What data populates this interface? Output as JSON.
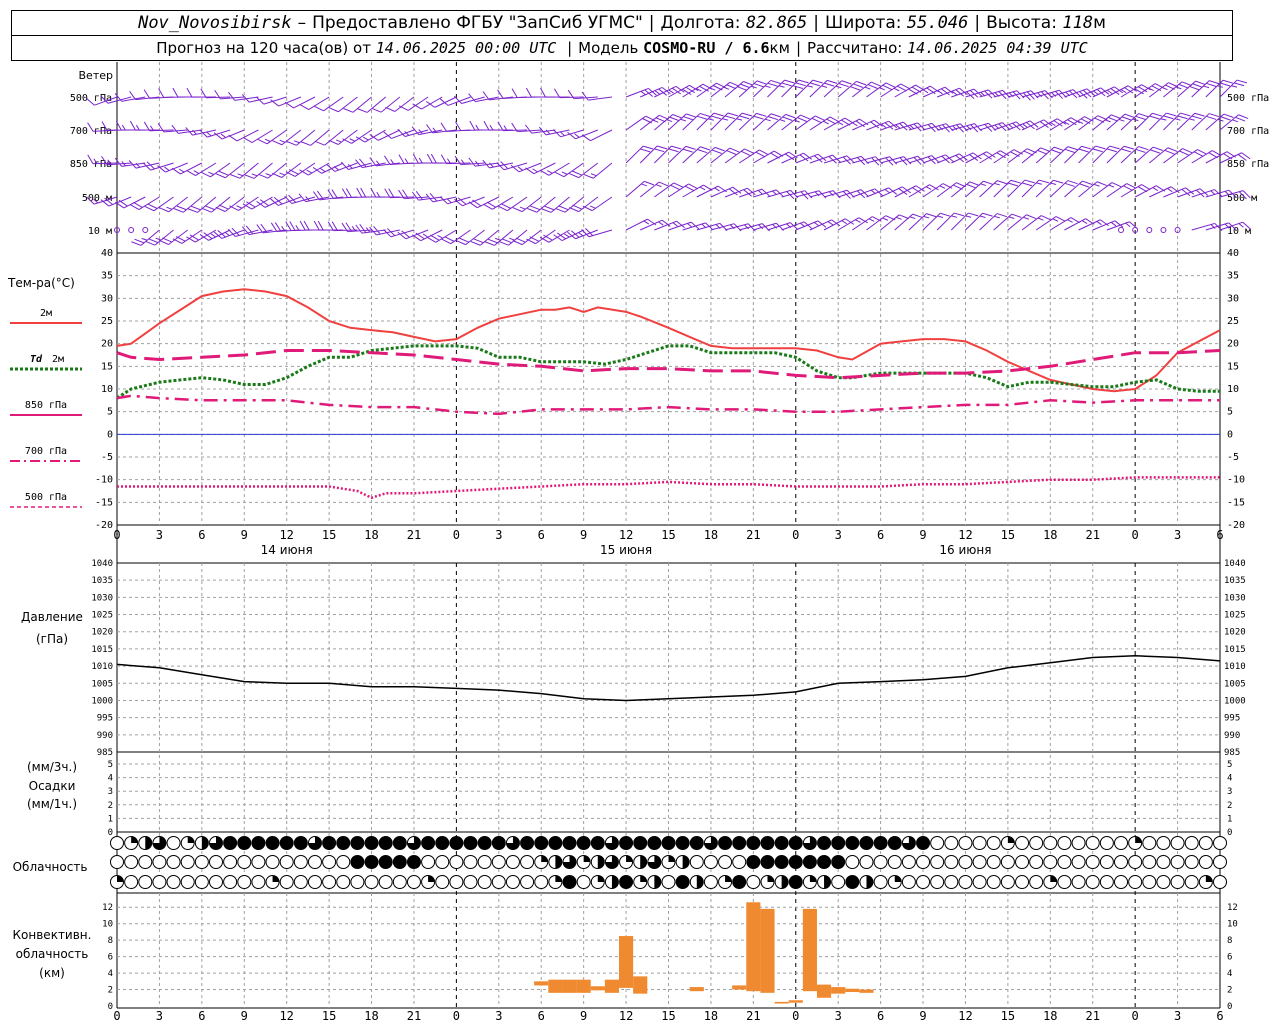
{
  "header": {
    "line1": {
      "station": "Nov_Novosibirsk",
      "dash": "–",
      "provided": "Предоставлено ФГБУ \"ЗапСиб УГМС\"",
      "lon_label": "Долгота:",
      "lon": "82.865",
      "lat_label": "Широта:",
      "lat": "55.046",
      "alt_label": "Высота:",
      "alt": "118",
      "alt_unit": "м"
    },
    "line2": {
      "forecast": "Прогноз на 120 часа(ов) от",
      "from": "14.06.2025 00:00 UTC",
      "model_label": "Модель",
      "model": "COSMO-RU / 6.6",
      "model_unit": "км",
      "calc_label": "Рассчитано:",
      "calc": "14.06.2025 04:39 UTC"
    }
  },
  "labels": {
    "wind": "Ветер",
    "wind_levels": [
      "500 гПа",
      "700 гПа",
      "850 гПа",
      "500 м",
      "10  м"
    ],
    "temp_title": "Тем-ра(°С)",
    "t2m": "2м",
    "td_prefix": "Td",
    "td_suffix": "2м",
    "t850": "850 гПа",
    "t700": "700 гПа",
    "t500": "500 гПа",
    "pressure": "Давление",
    "pressure_unit": "(гПа)",
    "precip_unit3": "(мм/3ч.)",
    "precip": "Осадки",
    "precip_unit1": "(мм/1ч.)",
    "clouds": "Облачность",
    "conv1": "Конвективн.",
    "conv2": "облачность",
    "conv3": "(км)"
  },
  "colors": {
    "wind": "#7a22cc",
    "t2m": "#f04040",
    "td2m": "#1a7a1a",
    "t850": "#e01a78",
    "t700": "#e01a78",
    "t500": "#e01a78",
    "zero": "#2a3ad0",
    "pressure": "#000000",
    "conv": "#f08a30",
    "grid": "#a0a0a0"
  },
  "chart_data": {
    "type": "meteogram",
    "time_axis": {
      "tick_labels": [
        "0",
        "3",
        "6",
        "9",
        "12",
        "15",
        "18",
        "21",
        "0",
        "3",
        "6",
        "9",
        "12",
        "15",
        "18",
        "21",
        "0",
        "3",
        "6",
        "9",
        "12",
        "15",
        "18",
        "21",
        "0",
        "3",
        "6"
      ],
      "day_labels": [
        "14 июня",
        "15 июня",
        "16 июня"
      ],
      "hours": [
        0,
        3,
        6,
        9,
        12,
        15,
        18,
        21,
        24,
        27,
        30,
        33,
        36,
        39,
        42,
        45,
        48,
        51,
        54,
        57,
        60,
        63,
        66,
        69,
        72,
        75,
        78
      ],
      "range_hours": [
        0,
        78
      ]
    },
    "temperature": {
      "ylim": [
        -20,
        40
      ],
      "yticks": [
        -20,
        -15,
        -10,
        -5,
        0,
        5,
        10,
        15,
        20,
        25,
        30,
        35,
        40
      ],
      "series": [
        {
          "name": "2м",
          "style": "solid",
          "x": [
            0,
            1,
            3,
            6,
            7.5,
            9,
            10.5,
            12,
            13.5,
            15,
            16.5,
            18,
            19.5,
            21,
            22.5,
            24,
            25.5,
            27,
            28.5,
            30,
            31,
            32,
            33,
            34,
            36,
            37,
            39,
            40.5,
            42,
            43.5,
            45,
            46.5,
            48,
            49.5,
            51,
            52,
            54,
            55.5,
            57,
            58.5,
            60,
            61.5,
            63,
            64.5,
            66,
            67.5,
            69,
            70.5,
            72,
            73.5,
            75,
            76.5,
            78
          ],
          "values": [
            19.5,
            20,
            24.5,
            30.5,
            31.5,
            32,
            31.5,
            30.5,
            28,
            25,
            23.5,
            23,
            22.5,
            21.5,
            20.5,
            21,
            23.5,
            25.5,
            26.5,
            27.5,
            27.5,
            28,
            27,
            28,
            27,
            26,
            23.5,
            21.5,
            19.5,
            19,
            19,
            19,
            19,
            18.5,
            17,
            16.5,
            20,
            20.5,
            21,
            21,
            20.5,
            18.5,
            16,
            14,
            12,
            11,
            10,
            9.5,
            10,
            13,
            18,
            20.5,
            23
          ]
        },
        {
          "name": "Td 2м",
          "style": "dotted",
          "x": [
            0,
            1,
            3,
            4.5,
            6,
            7.5,
            9,
            10.5,
            12,
            13.5,
            15,
            16.5,
            18,
            19.5,
            21,
            22.5,
            24,
            25.5,
            27,
            28.5,
            30,
            31.5,
            33,
            34.5,
            36,
            37.5,
            39,
            40.5,
            42,
            43.5,
            45,
            46.5,
            48,
            49.5,
            51,
            52,
            54,
            55.5,
            57,
            58.5,
            60,
            61.5,
            63,
            64.5,
            66,
            67.5,
            69,
            70.5,
            72,
            73.5,
            75,
            76.5,
            78
          ],
          "values": [
            8,
            10,
            11.5,
            12,
            12.5,
            12,
            11,
            11,
            12.5,
            15,
            17,
            17,
            18.5,
            19,
            19.5,
            19.5,
            19.5,
            19,
            17,
            17,
            16,
            16,
            16,
            15.5,
            16.5,
            18,
            19.5,
            19.5,
            18,
            18,
            18,
            18,
            17,
            14,
            12.5,
            12.5,
            13.5,
            13.5,
            13.5,
            13.5,
            13.5,
            12.5,
            10.5,
            11.5,
            11.5,
            11,
            10.5,
            10.5,
            11.5,
            12,
            10,
            9.5,
            9.5
          ]
        },
        {
          "name": "850 гПа",
          "style": "dashed",
          "x": [
            0,
            1,
            3,
            6,
            9,
            12,
            15,
            18,
            21,
            24,
            27,
            30,
            33,
            36,
            39,
            42,
            45,
            48,
            51,
            54,
            57,
            60,
            63,
            66,
            69,
            72,
            75,
            78
          ],
          "values": [
            18,
            17,
            16.5,
            17,
            17.5,
            18.5,
            18.5,
            18,
            17.5,
            16.5,
            15.5,
            15,
            14,
            14.5,
            14.5,
            14,
            14,
            13,
            12.5,
            13,
            13.5,
            13.5,
            14,
            15,
            16.5,
            18,
            18,
            18.5
          ]
        },
        {
          "name": "700 гПа",
          "style": "dashdot",
          "x": [
            0,
            1,
            3,
            6,
            9,
            12,
            15,
            18,
            21,
            24,
            27,
            30,
            33,
            36,
            39,
            42,
            45,
            48,
            51,
            54,
            57,
            60,
            63,
            66,
            69,
            72,
            75,
            78
          ],
          "values": [
            8,
            8.5,
            8,
            7.5,
            7.5,
            7.5,
            6.5,
            6,
            6,
            5,
            4.5,
            5.5,
            5.5,
            5.5,
            6,
            5.5,
            5.5,
            5,
            5,
            5.5,
            6,
            6.5,
            6.5,
            7.5,
            7,
            7.5,
            7.5,
            7.5
          ]
        },
        {
          "name": "500 гПа",
          "style": "dotted-fine",
          "x": [
            0,
            1,
            3,
            6,
            9,
            12,
            15,
            17,
            18,
            19,
            21,
            24,
            27,
            30,
            33,
            36,
            39,
            42,
            45,
            48,
            51,
            54,
            57,
            60,
            63,
            66,
            69,
            72,
            75,
            78
          ],
          "values": [
            -11.5,
            -11.5,
            -11.5,
            -11.5,
            -11.5,
            -11.5,
            -11.5,
            -12.5,
            -14,
            -13,
            -13,
            -12.5,
            -12,
            -11.5,
            -11,
            -11,
            -10.5,
            -11,
            -11,
            -11.5,
            -11.5,
            -11.5,
            -11,
            -11,
            -10.5,
            -10,
            -10,
            -9.5,
            -9.5,
            -9.5
          ]
        }
      ]
    },
    "pressure": {
      "ylim": [
        985,
        1040
      ],
      "yticks": [
        985,
        990,
        995,
        1000,
        1005,
        1010,
        1015,
        1020,
        1025,
        1030,
        1035,
        1040
      ],
      "x": [
        0,
        1.5,
        3,
        6,
        9,
        12,
        15,
        18,
        21,
        24,
        27,
        30,
        33,
        36,
        39,
        42,
        45,
        48,
        51,
        54,
        57,
        60,
        63,
        66,
        69,
        72,
        75,
        78
      ],
      "values": [
        1010.5,
        1010,
        1009.5,
        1007.5,
        1005.5,
        1005,
        1005,
        1004,
        1004,
        1003.5,
        1003,
        1002,
        1000.5,
        1000,
        1000.5,
        1001,
        1001.5,
        1002.5,
        1005,
        1005.5,
        1006,
        1007,
        1009.5,
        1011,
        1012.5,
        1013,
        1012.5,
        1011.5
      ]
    },
    "precipitation": {
      "ylim": [
        0,
        5
      ],
      "yticks": [
        0,
        1,
        2,
        3,
        4,
        5
      ],
      "values": []
    },
    "cloudiness": {
      "rows": [
        "high",
        "middle",
        "low"
      ],
      "scale": "0-4 (quarters of circle filled)",
      "hours_step": 1
    },
    "convective_clouds": {
      "ylim": [
        0,
        13
      ],
      "yticks": [
        0,
        2,
        4,
        6,
        8,
        10,
        12
      ],
      "bars": [
        {
          "x": 30,
          "bottom": 2.5,
          "top": 3
        },
        {
          "x": 31,
          "bottom": 1.6,
          "top": 3.2
        },
        {
          "x": 32,
          "bottom": 1.6,
          "top": 3.2
        },
        {
          "x": 33,
          "bottom": 1.6,
          "top": 3.2
        },
        {
          "x": 34,
          "bottom": 1.9,
          "top": 2.4
        },
        {
          "x": 35,
          "bottom": 1.6,
          "top": 3.2
        },
        {
          "x": 36,
          "bottom": 2.2,
          "top": 8.5
        },
        {
          "x": 37,
          "bottom": 1.5,
          "top": 3.6
        },
        {
          "x": 41,
          "bottom": 1.8,
          "top": 2.3
        },
        {
          "x": 44,
          "bottom": 2.0,
          "top": 2.5
        },
        {
          "x": 45,
          "bottom": 1.8,
          "top": 12.6
        },
        {
          "x": 46,
          "bottom": 1.6,
          "top": 11.8
        },
        {
          "x": 47,
          "bottom": 0.3,
          "top": 0.5
        },
        {
          "x": 48,
          "bottom": 0.4,
          "top": 0.7
        },
        {
          "x": 49,
          "bottom": 1.8,
          "top": 11.8
        },
        {
          "x": 50,
          "bottom": 1.0,
          "top": 2.6
        },
        {
          "x": 51,
          "bottom": 1.5,
          "top": 2.3
        },
        {
          "x": 52,
          "bottom": 1.7,
          "top": 2.1
        },
        {
          "x": 53,
          "bottom": 1.6,
          "top": 2.0
        }
      ]
    }
  }
}
